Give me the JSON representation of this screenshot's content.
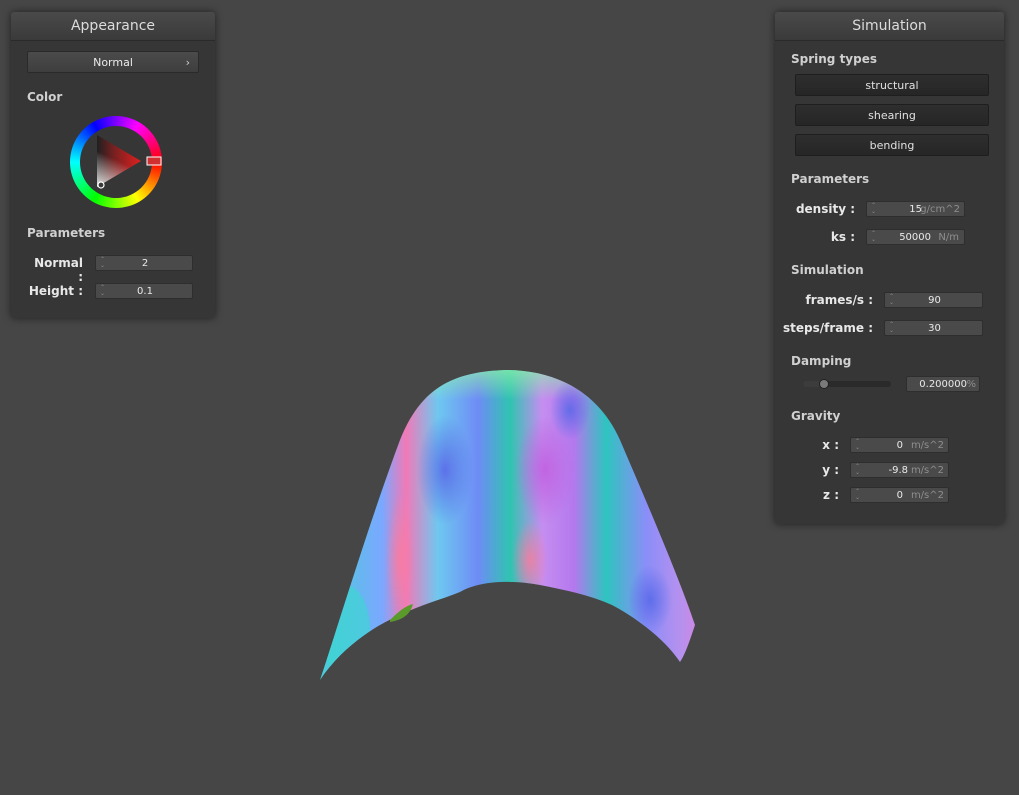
{
  "appearance": {
    "title": "Appearance",
    "shader_selected": "Normal",
    "color_label": "Color",
    "params_label": "Parameters",
    "normal_label": "Normal :",
    "normal_value": "2",
    "height_label": "Height :",
    "height_value": "0.1"
  },
  "simulation": {
    "title": "Simulation",
    "spring_types_label": "Spring types",
    "spring_buttons": [
      "structural",
      "shearing",
      "bending"
    ],
    "parameters_label": "Parameters",
    "density_label": "density :",
    "density_value": "15",
    "density_unit": "g/cm^2",
    "ks_label": "ks :",
    "ks_value": "50000",
    "ks_unit": "N/m",
    "sim_label": "Simulation",
    "fps_label": "frames/s :",
    "fps_value": "90",
    "steps_label": "steps/frame :",
    "steps_value": "30",
    "damping_label": "Damping",
    "damping_value": "0.200000",
    "damping_unit": "%",
    "damping_fraction": 0.2,
    "gravity_label": "Gravity",
    "gx_label": "x :",
    "gx_value": "0",
    "gy_label": "y :",
    "gy_value": "-9.8",
    "gz_label": "z :",
    "gz_value": "0",
    "gravity_unit": "m/s^2"
  },
  "colors": {
    "background": "#464646",
    "panel": "#363636",
    "picked_color": "#d03030"
  },
  "icons": {
    "dropdown": "chevron-right-icon",
    "spinner": "spinner-arrows-icon"
  }
}
